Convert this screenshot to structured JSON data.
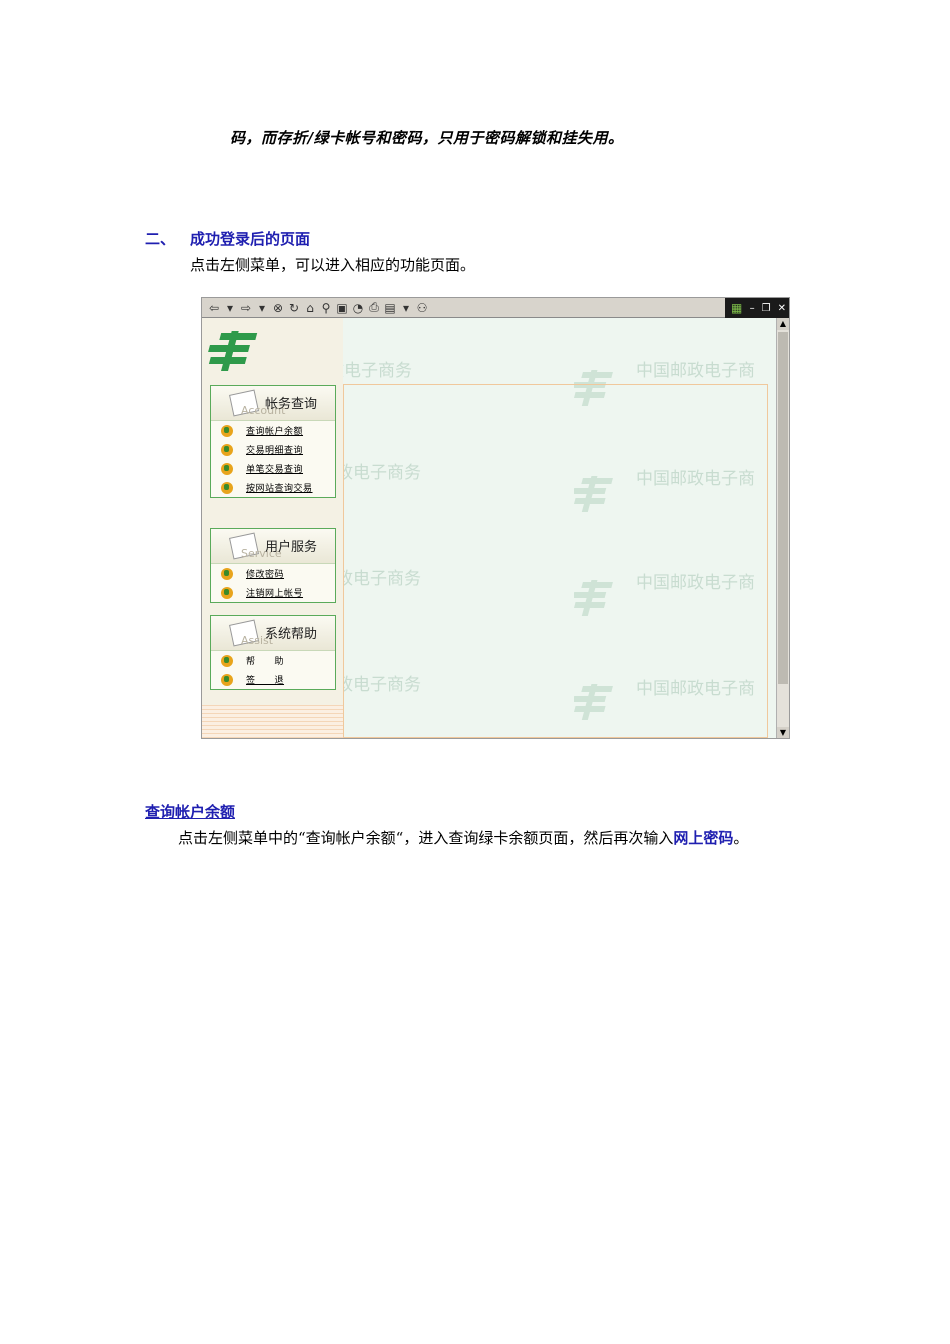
{
  "doc": {
    "line_top": "码，而存折/绿卡帐号和密码，只用于密码解锁和挂失用。",
    "section2": {
      "number": "二、",
      "title": "成功登录后的页面",
      "desc": "点击左侧菜单，可以进入相应的功能页面。"
    },
    "query": {
      "link": "查询帐户余额",
      "desc_before": "点击左侧菜单中的“查询帐户余额“，进入查询绿卡余额页面，然后再次输入",
      "desc_highlight": "网上密码",
      "desc_after": "。"
    }
  },
  "screenshot": {
    "watermark_text": "中国邮政电子商务",
    "watermark_right": "中国邮政电子商",
    "watermark_partial": "政电子商务",
    "menus": [
      {
        "title": "帐务查询",
        "subtitle": "Account",
        "items": [
          "查询帐户余额",
          "交易明细查询",
          "单笔交易查询",
          "按网站查询交易"
        ]
      },
      {
        "title": "用户服务",
        "subtitle": "Service",
        "items": [
          "修改密码",
          "注销网上帐号"
        ]
      },
      {
        "title": "系统帮助",
        "subtitle": "Assist",
        "items": [
          "帮　　助",
          "签　　退"
        ]
      }
    ],
    "colors": {
      "brand_green": "#2e9a4a",
      "link_blue": "#1f1fb0",
      "menu_border": "#5aaa5a"
    }
  }
}
